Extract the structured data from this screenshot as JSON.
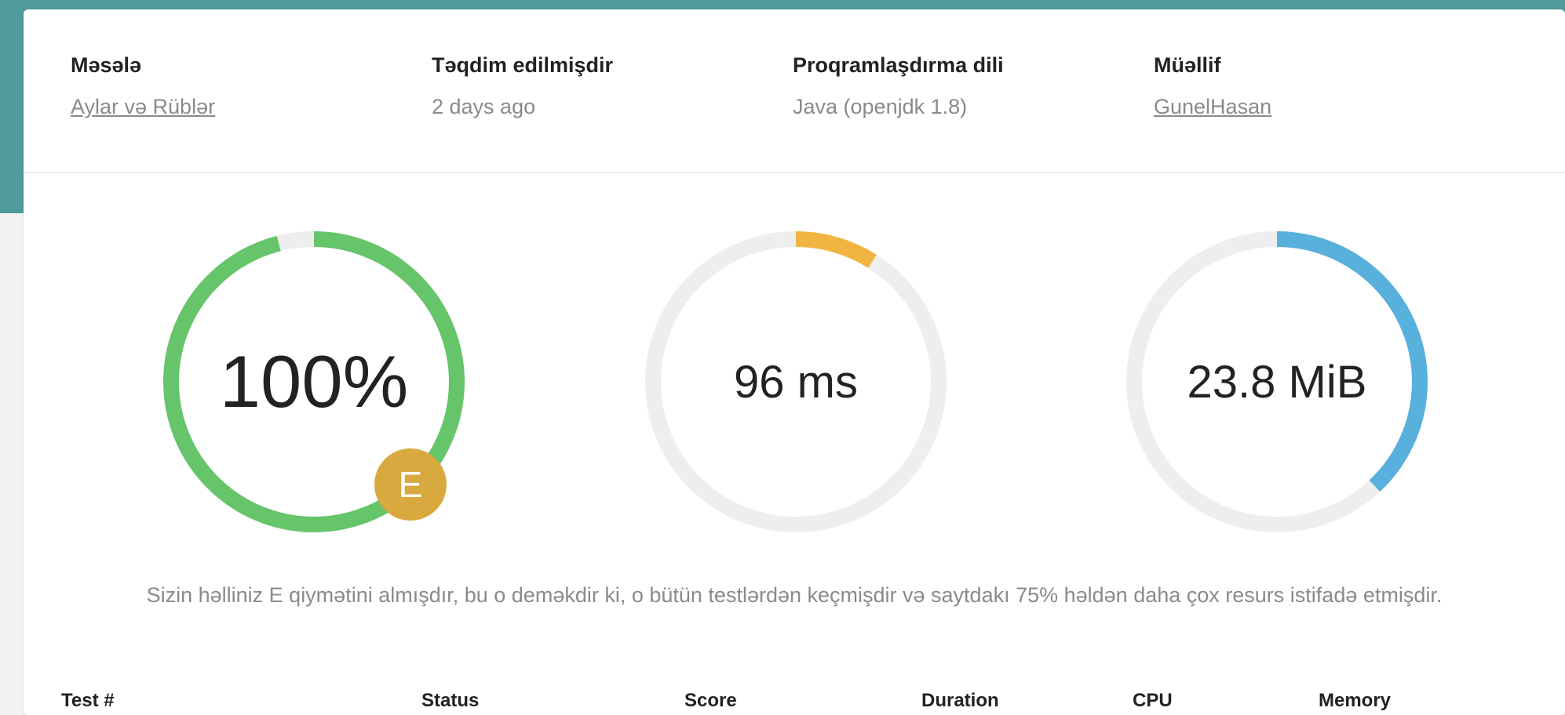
{
  "meta": {
    "problem": {
      "label": "Məsələ",
      "value": "Aylar və Rüblər"
    },
    "submitted": {
      "label": "Təqdim edilmişdir",
      "value": "2 days ago"
    },
    "language": {
      "label": "Proqramlaşdırma dili",
      "value": "Java (openjdk 1.8)"
    },
    "author": {
      "label": "Müəllif",
      "value": "GunelHasan"
    }
  },
  "gauges": {
    "score": {
      "value": "100%",
      "fraction": 0.96,
      "color": "#66c46b"
    },
    "time": {
      "value": "96 ms",
      "fraction": 0.09,
      "color": "#f2b441"
    },
    "memory": {
      "value": "23.8 MiB",
      "fraction": 0.38,
      "color": "#58b0dc"
    },
    "track_color": "#eeeeee"
  },
  "grade": {
    "letter": "E",
    "color": "#d8a93e"
  },
  "summary": "Sizin həlliniz E qiymətini almışdır, bu o deməkdir ki, o bütün testlərdən keçmişdir və saytdakı 75% həldən daha çox resurs istifadə etmişdir.",
  "table": {
    "headers": [
      "Test #",
      "Status",
      "Score",
      "Duration",
      "CPU",
      "Memory"
    ]
  }
}
